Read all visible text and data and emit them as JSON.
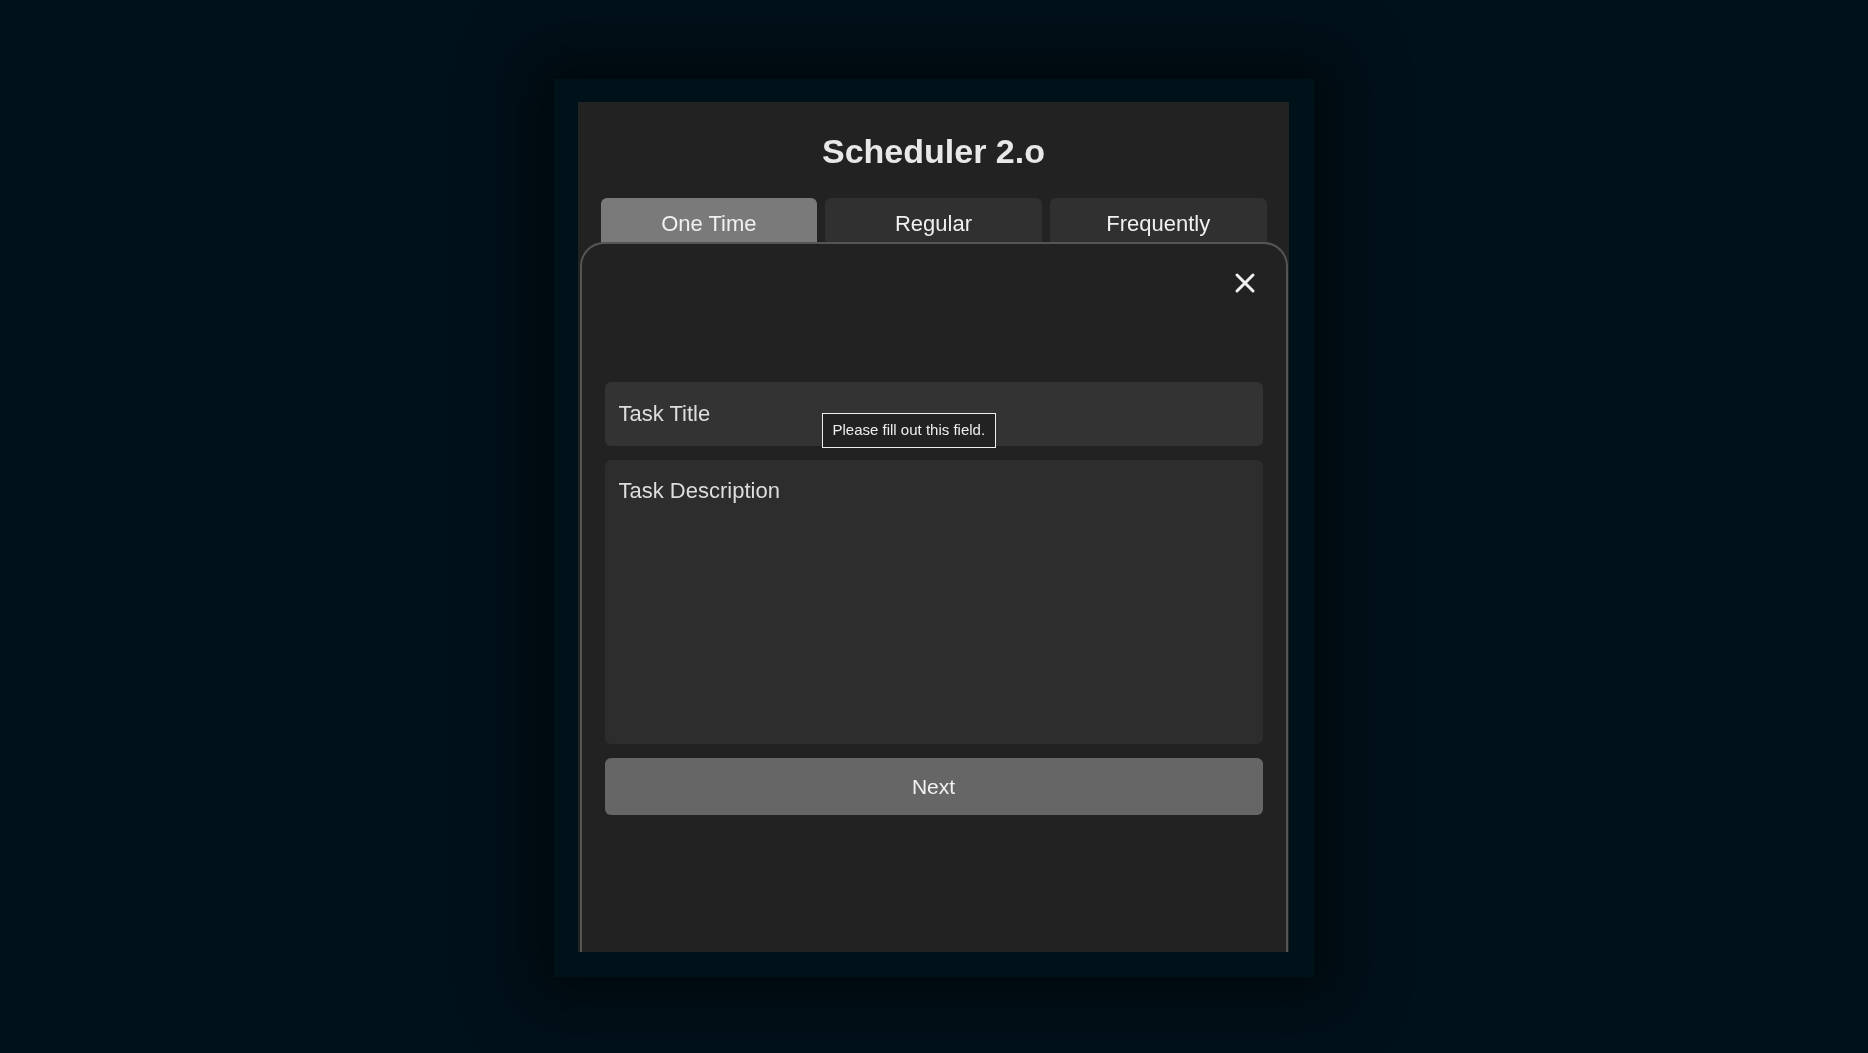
{
  "app": {
    "title": "Scheduler 2.o"
  },
  "tabs": [
    {
      "label": "One Time",
      "selected": true
    },
    {
      "label": "Regular",
      "selected": false
    },
    {
      "label": "Frequently",
      "selected": false
    }
  ],
  "form": {
    "title_field": {
      "placeholder": "Task Title"
    },
    "validation_tooltip": "Please fill out this field.",
    "description_field": {
      "placeholder": "Task Description"
    },
    "next_button": "Next"
  }
}
